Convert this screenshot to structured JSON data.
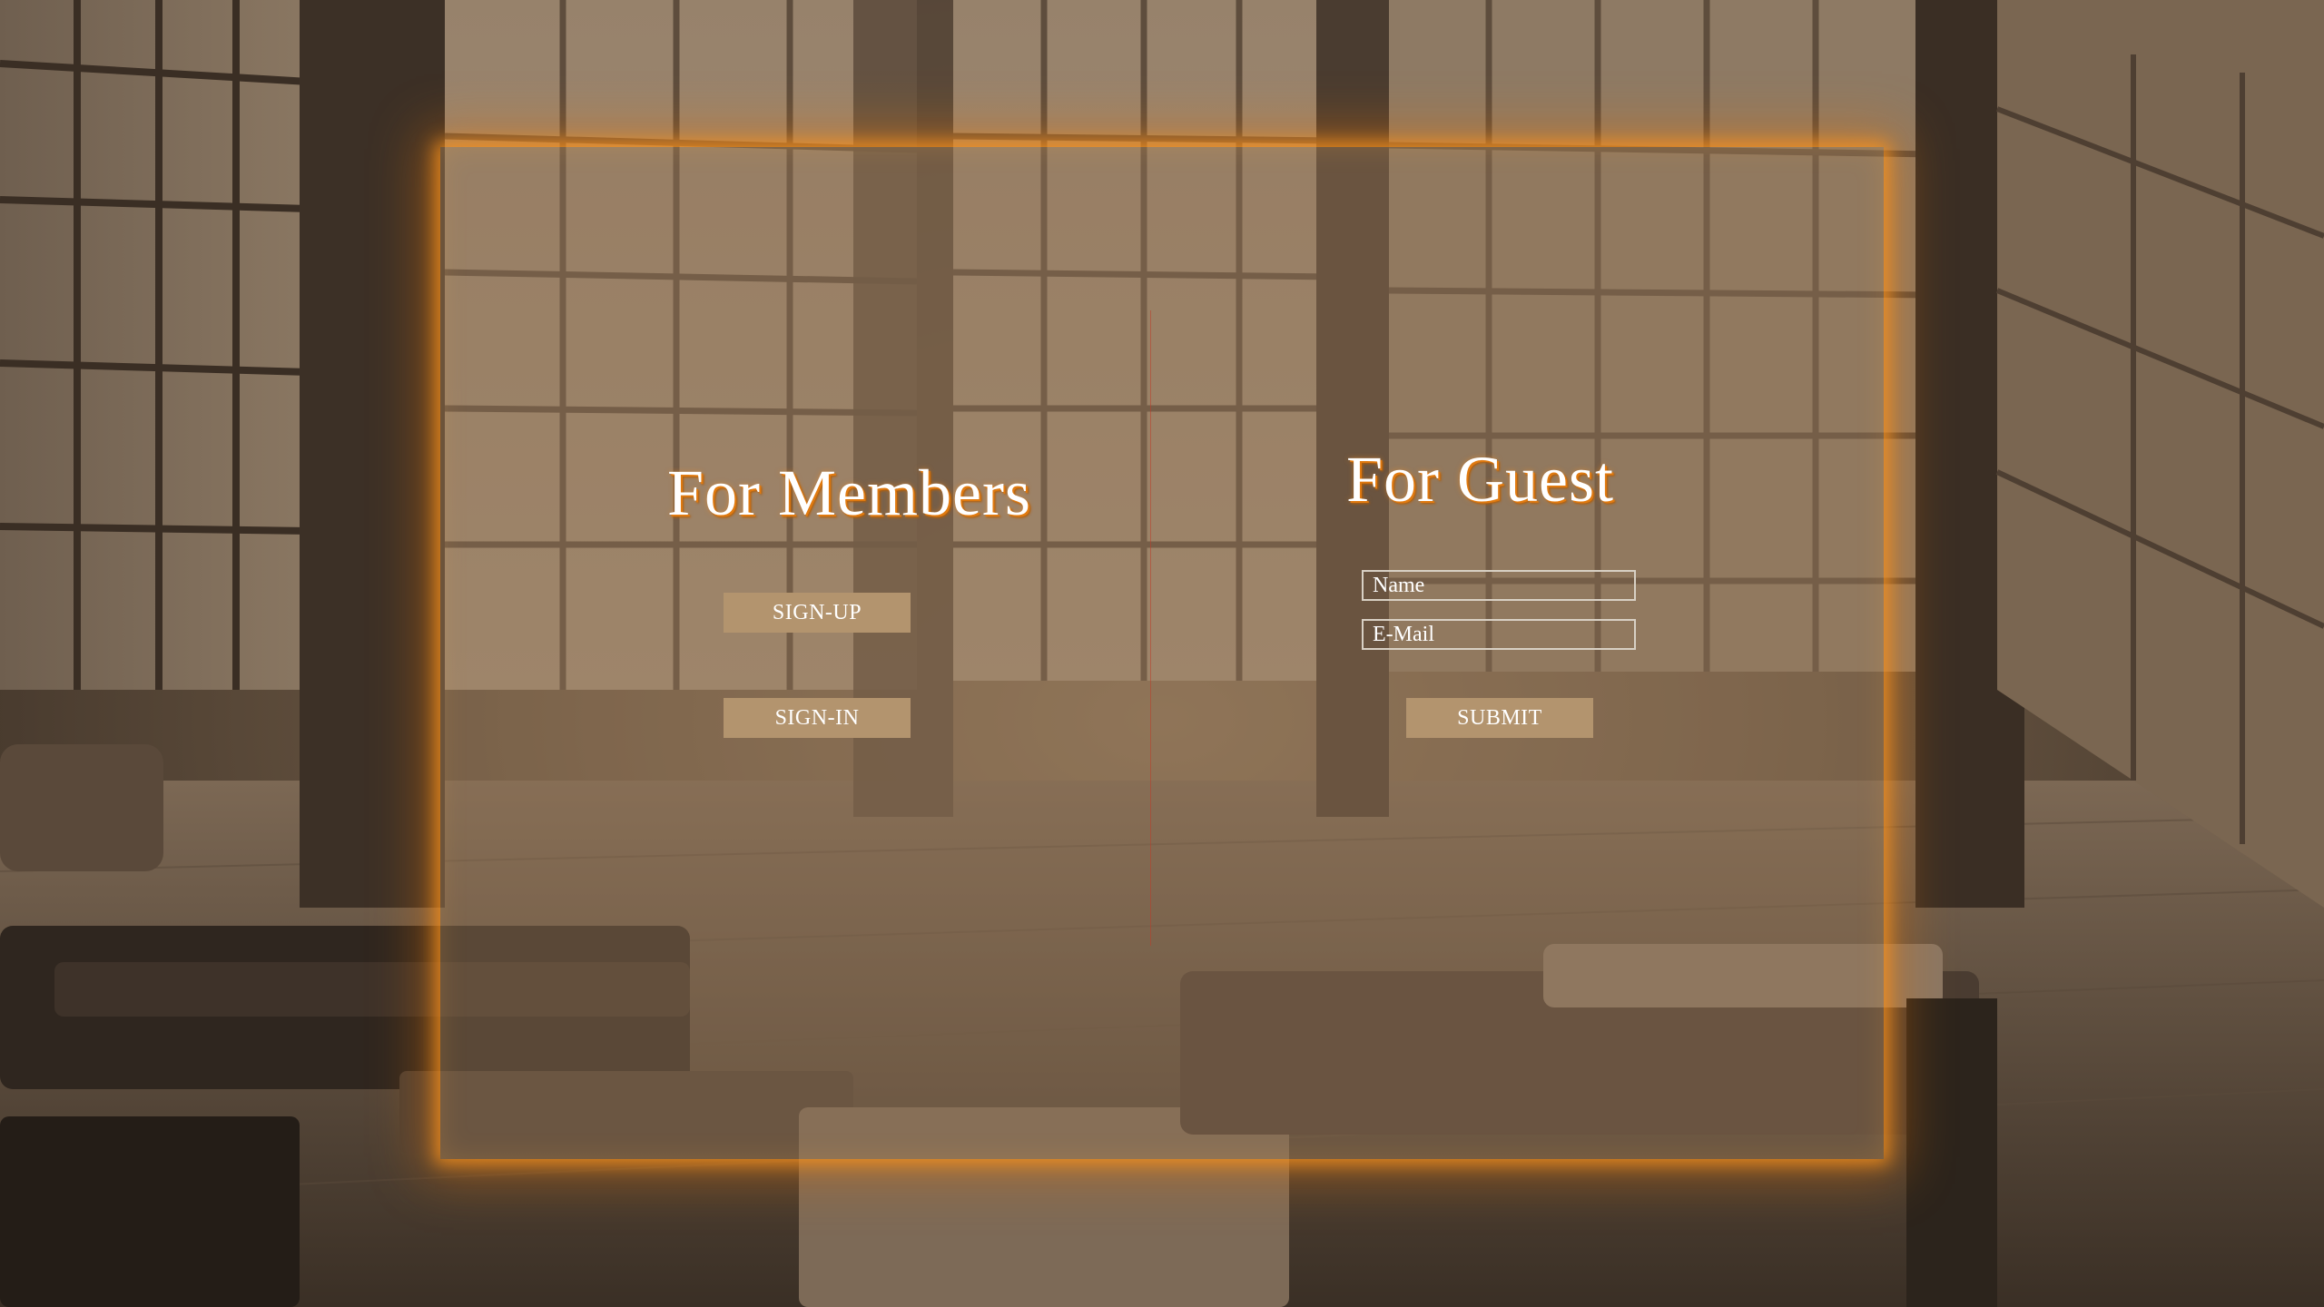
{
  "members": {
    "heading": "For Members",
    "signup_label": "SIGN-UP",
    "signin_label": "SIGN-IN"
  },
  "guest": {
    "heading": "For Guest",
    "name_placeholder": "Name",
    "email_placeholder": "E-Mail",
    "submit_label": "SUBMIT"
  },
  "colors": {
    "panel_glow": "#ff961e",
    "button_bg": "#b3946e",
    "heading_shadow": "#e07a10",
    "divider": "#be3c28"
  }
}
